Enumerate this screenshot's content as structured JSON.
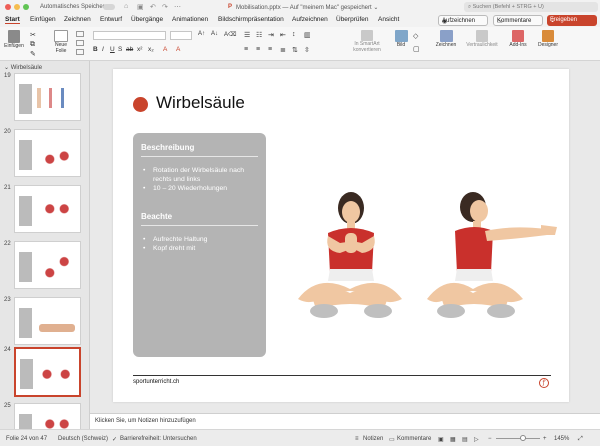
{
  "titlebar": {
    "autosave_label": "Automatisches Speichern",
    "doc_title": "Mobilisation.pptx — Auf \"meinem Mac\" gespeichert ⌄",
    "search_placeholder": "Suchen (Befehl + STRG + U)"
  },
  "tabs": [
    "Start",
    "Einfügen",
    "Zeichnen",
    "Entwurf",
    "Übergänge",
    "Animationen",
    "Bildschirmpräsentation",
    "Aufzeichnen",
    "Überprüfen",
    "Ansicht"
  ],
  "record_button": "Aufzeichnen",
  "comment_button": "Kommentare",
  "share_button": "Freigeben",
  "ribbon": {
    "paste": "Einfügen",
    "new_slide": "Neue Folie",
    "smartart": "In SmartArt konvertieren",
    "picture": "Bild",
    "draw": "Zeichnen",
    "crop": "Vertraulichkeit",
    "addins": "Add-Ins",
    "designer": "Designer"
  },
  "section_label": "Wirbelsäule",
  "thumbnail_numbers": [
    "19",
    "20",
    "21",
    "22",
    "23",
    "24",
    "25"
  ],
  "slide": {
    "title": "Wirbelsäule",
    "section1_heading": "Beschreibung",
    "section1_items": [
      "Rotation der Wirbelsäule nach rechts und links",
      "10 – 20 Wiederholungen"
    ],
    "section2_heading": "Beachte",
    "section2_items": [
      "Aufrechte Haltung",
      "Kopf dreht mit"
    ],
    "footer_text": "sportunterricht.ch"
  },
  "notes_placeholder": "Klicken Sie, um Notizen hinzuzufügen",
  "status": {
    "slide_info": "Folie 24 von 47",
    "language": "Deutsch (Schweiz)",
    "accessibility": "Barrierefreiheit: Untersuchen",
    "notes": "Notizen",
    "comments": "Kommentare",
    "zoom": "145%"
  },
  "colors": {
    "accent": "#c9442c",
    "panel_gray": "#b4b4b4"
  }
}
